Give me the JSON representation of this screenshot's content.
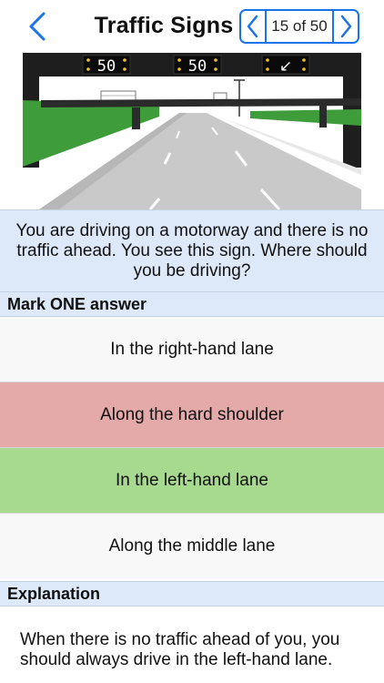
{
  "header": {
    "title": "Traffic Signs",
    "pager": "15 of 50"
  },
  "scene": {
    "signs": [
      "50",
      "50",
      "↙"
    ]
  },
  "question": {
    "text": "You are driving on a motorway and there is no traffic ahead. You see this sign. Where should you be driving?"
  },
  "answers_section": {
    "title": "Mark ONE answer",
    "answers": [
      {
        "label": "In the right-hand lane",
        "state": "neutral"
      },
      {
        "label": "Along the hard shoulder",
        "state": "wrong"
      },
      {
        "label": "In the left-hand lane",
        "state": "correct"
      },
      {
        "label": "Along the middle lane",
        "state": "neutral"
      }
    ]
  },
  "explanation": {
    "title": "Explanation",
    "text": "When there is no traffic ahead of you, you should always drive in the left-hand lane."
  },
  "colors": {
    "accent": "#1a73e8",
    "wrong": "#e4aaa9",
    "correct": "#a7d98f",
    "section_bg": "#dde9f8"
  }
}
